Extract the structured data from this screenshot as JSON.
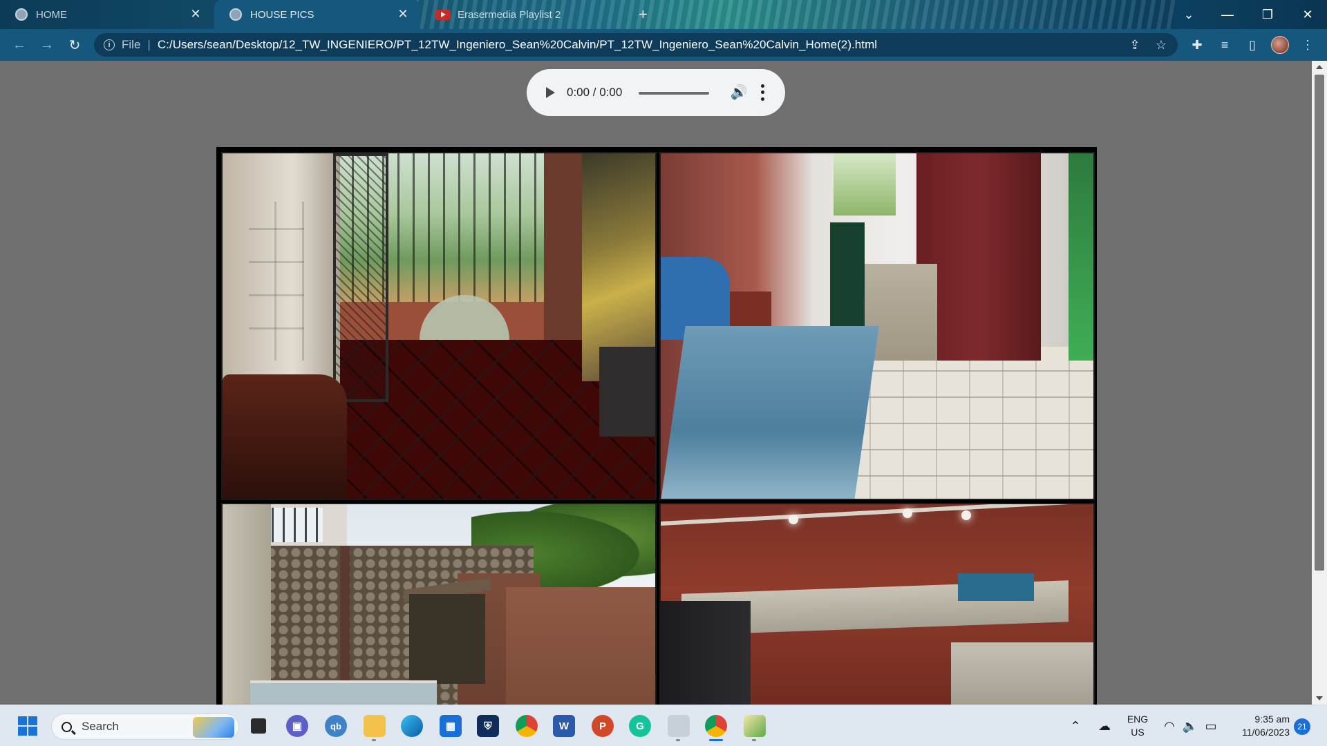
{
  "browser": {
    "tabs": [
      {
        "label": "HOME",
        "active": false
      },
      {
        "label": "HOUSE PICS",
        "active": true
      },
      {
        "label": "Erasermedia Playlist 2",
        "active": false
      }
    ],
    "new_tab_symbol": "+",
    "window_controls": {
      "menu": "⌄",
      "minimize": "—",
      "restore": "❐",
      "close": "✕"
    },
    "address": {
      "scheme_label": "File",
      "separator": "|",
      "url": "C:/Users/sean/Desktop/12_TW_INGENIERO/PT_12TW_Ingeniero_Sean%20Calvin/PT_12TW_Ingeniero_Sean%20Calvin_Home(2).html"
    },
    "icons": [
      "back-icon",
      "forward-icon",
      "reload-icon",
      "info-icon",
      "share-icon",
      "star-icon",
      "extensions-icon",
      "media-icon",
      "side-panel-icon",
      "profile-avatar",
      "menu-icon"
    ]
  },
  "audio_player": {
    "time": "0:00 / 0:00",
    "progress": 0
  },
  "gallery": {
    "photos": [
      {
        "subject": "porch"
      },
      {
        "subject": "bedroom"
      },
      {
        "subject": "courtyard"
      },
      {
        "subject": "kitchen"
      }
    ]
  },
  "taskbar": {
    "search_label": "Search",
    "apps": [
      "start",
      "search",
      "task-view",
      "teams",
      "qbittorrent",
      "file-explorer",
      "edge",
      "store",
      "ms-outlook",
      "chrome",
      "word",
      "powerpoint",
      "grammarly",
      "snipping-tool",
      "chrome-profile",
      "photo-app"
    ],
    "tray": {
      "language": "ENG",
      "region": "US",
      "time": "9:35 am",
      "date": "11/06/2023",
      "notifications": "21"
    }
  },
  "colors": {
    "tab_bar": "#0c3b57",
    "toolbar": "#16577e",
    "page_bg": "#6f6f6f",
    "taskbar": "#dfe8f1",
    "accent": "#1a6fd6"
  }
}
